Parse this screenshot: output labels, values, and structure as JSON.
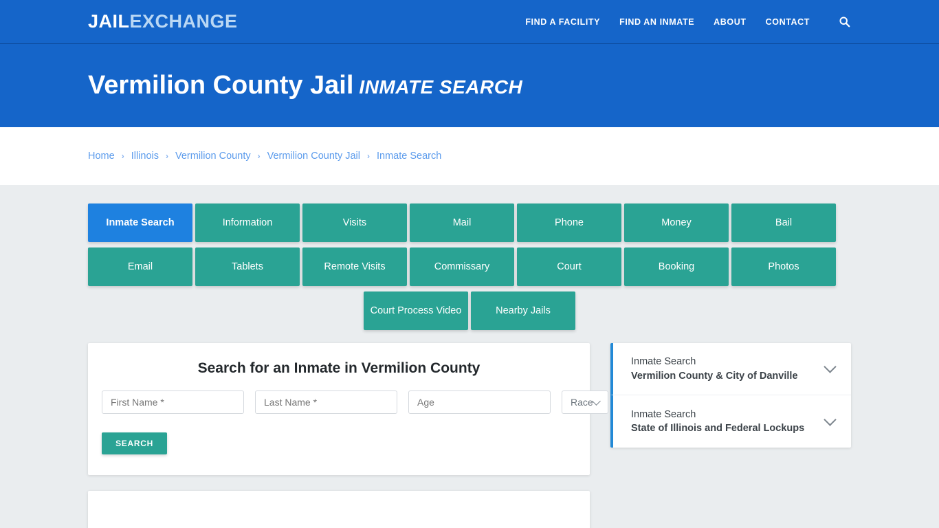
{
  "header": {
    "logo_primary": "JAIL",
    "logo_secondary": "EXCHANGE",
    "nav": [
      {
        "label": "FIND A FACILITY"
      },
      {
        "label": "FIND AN INMATE"
      },
      {
        "label": "ABOUT"
      },
      {
        "label": "CONTACT"
      }
    ],
    "search_icon": "search-icon",
    "bar_color": "#1565c9"
  },
  "hero": {
    "title": "Vermilion County Jail",
    "subtitle": "INMATE SEARCH"
  },
  "breadcrumb": {
    "items": [
      {
        "label": "Home"
      },
      {
        "label": "Illinois"
      },
      {
        "label": "Vermilion County"
      },
      {
        "label": "Vermilion County Jail"
      },
      {
        "label": "Inmate Search"
      }
    ],
    "separator": "›",
    "link_color": "#5b9bec"
  },
  "tabs": {
    "active_color": "#1e81e0",
    "inactive_color": "#2aa394",
    "row1": [
      {
        "label": "Inmate Search",
        "active": true
      },
      {
        "label": "Information",
        "active": false
      },
      {
        "label": "Visits",
        "active": false
      },
      {
        "label": "Mail",
        "active": false
      },
      {
        "label": "Phone",
        "active": false
      },
      {
        "label": "Money",
        "active": false
      },
      {
        "label": "Bail",
        "active": false
      }
    ],
    "row2": [
      {
        "label": "Email",
        "active": false
      },
      {
        "label": "Tablets",
        "active": false
      },
      {
        "label": "Remote Visits",
        "active": false
      },
      {
        "label": "Commissary",
        "active": false
      },
      {
        "label": "Court",
        "active": false
      },
      {
        "label": "Booking",
        "active": false
      },
      {
        "label": "Photos",
        "active": false
      }
    ],
    "row3": [
      {
        "label": "Court Process Video",
        "active": false
      },
      {
        "label": "Nearby Jails",
        "active": false
      }
    ]
  },
  "search_form": {
    "heading": "Search for an Inmate in Vermilion County",
    "first_name": {
      "value": "",
      "placeholder": "First Name *"
    },
    "last_name": {
      "value": "",
      "placeholder": "Last Name *"
    },
    "age": {
      "value": "",
      "placeholder": "Age"
    },
    "race": {
      "selected": "Race"
    },
    "submit_label": "SEARCH",
    "submit_color": "#2aa394"
  },
  "sidebar": {
    "accent_color": "#2289d6",
    "items": [
      {
        "line1": "Inmate Search",
        "line2": "Vermilion County & City of Danville",
        "icon": "chevron-down-icon"
      },
      {
        "line1": "Inmate Search",
        "line2": "State of Illinois and Federal Lockups",
        "icon": "chevron-down-icon"
      }
    ]
  }
}
